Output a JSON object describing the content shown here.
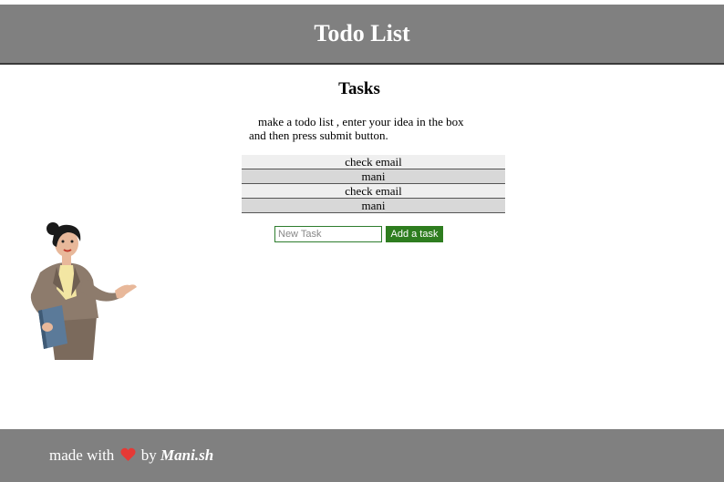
{
  "header": {
    "title": "Todo List"
  },
  "main": {
    "heading": "Tasks",
    "instructions_line1": "make a todo list , enter your idea in the box",
    "instructions_line2": "and then press submit button.",
    "tasks": [
      "check email",
      "mani",
      "check email",
      "mani"
    ],
    "form": {
      "input_placeholder": "New Task",
      "input_value": "",
      "submit_label": "Add a task"
    },
    "illustration": "businesswoman-presenting-illustration"
  },
  "footer": {
    "made_with": "made with",
    "heart_icon": "heart-icon",
    "by": "by",
    "author": "Mani.sh"
  },
  "colors": {
    "header_bg": "#808080",
    "footer_bg": "#808080",
    "button_bg": "#2e7d1f",
    "input_border": "#2e7d2e",
    "task_bg_light": "#efefef",
    "task_bg_dark": "#d8d8d8",
    "heart": "#e53935"
  }
}
